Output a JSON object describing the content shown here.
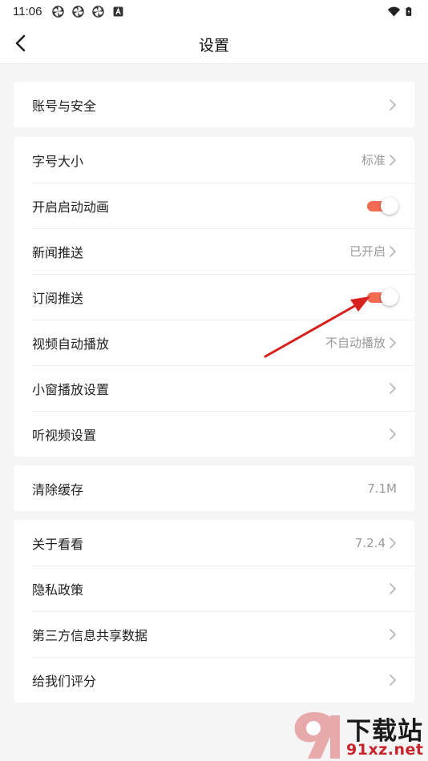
{
  "status_bar": {
    "time": "11:06",
    "left_icons": [
      "pinwheel-icon",
      "pinwheel-icon",
      "pinwheel-icon",
      "font-a-icon"
    ],
    "right_icons": [
      "wifi-icon",
      "battery-charging-icon"
    ]
  },
  "nav": {
    "title": "设置",
    "back_icon": "chevron-left-icon"
  },
  "groups": {
    "account": [
      {
        "label": "账号与安全",
        "value": "",
        "control": "chevron"
      }
    ],
    "preferences": [
      {
        "label": "字号大小",
        "value": "标准",
        "control": "chevron"
      },
      {
        "label": "开启启动动画",
        "value": "",
        "control": "toggle",
        "on": true
      },
      {
        "label": "新闻推送",
        "value": "已开启",
        "control": "chevron"
      },
      {
        "label": "订阅推送",
        "value": "",
        "control": "toggle",
        "on": true
      },
      {
        "label": "视频自动播放",
        "value": "不自动播放",
        "control": "chevron"
      },
      {
        "label": "小窗播放设置",
        "value": "",
        "control": "chevron"
      },
      {
        "label": "听视频设置",
        "value": "",
        "control": "chevron"
      }
    ],
    "cache": [
      {
        "label": "清除缓存",
        "value": "7.1M",
        "control": "none"
      }
    ],
    "about": [
      {
        "label": "关于看看",
        "value": "7.2.4",
        "control": "chevron"
      },
      {
        "label": "隐私政策",
        "value": "",
        "control": "chevron"
      },
      {
        "label": "第三方信息共享数据",
        "value": "",
        "control": "chevron"
      },
      {
        "label": "给我们评分",
        "value": "",
        "control": "chevron"
      }
    ]
  },
  "colors": {
    "toggle_on": "#f36a52",
    "annotation_arrow": "#d8201c",
    "watermark_red": "#c8232a"
  },
  "watermark": {
    "line1": "下载站",
    "line2": "91xz.net",
    "logo_icon": "91-logo-icon"
  }
}
